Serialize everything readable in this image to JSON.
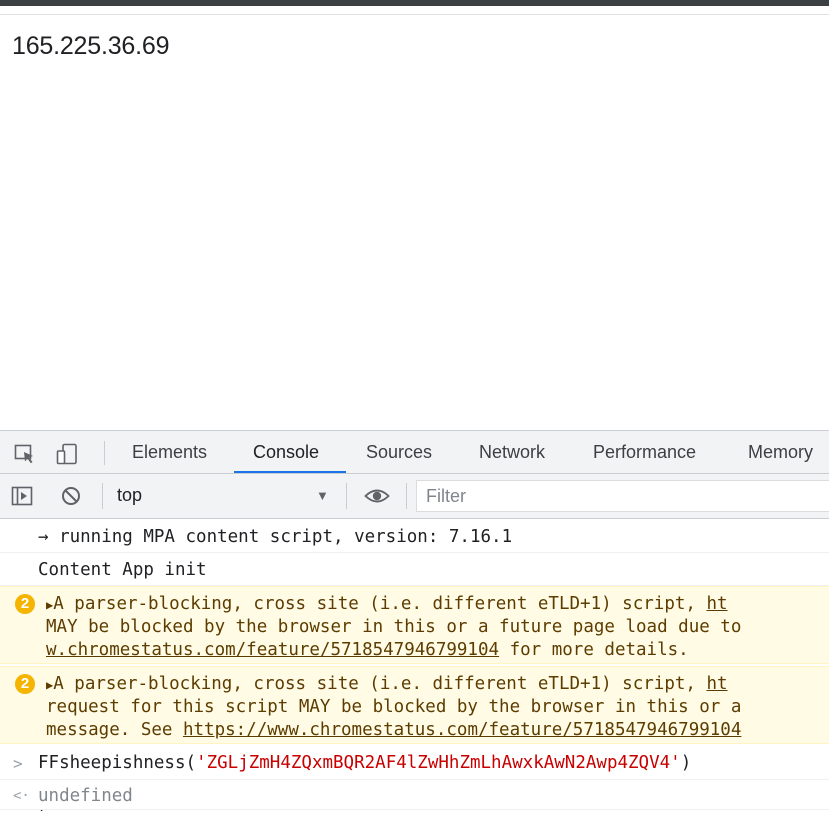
{
  "page": {
    "ip_text": "165.225.36.69"
  },
  "devtools": {
    "tabs": [
      {
        "label": "Elements"
      },
      {
        "label": "Console"
      },
      {
        "label": "Sources"
      },
      {
        "label": "Network"
      },
      {
        "label": "Performance"
      },
      {
        "label": "Memory"
      }
    ],
    "active_tab": "Console",
    "toolbar": {
      "context": "top",
      "filter_placeholder": "Filter"
    },
    "console": {
      "line1": "→ running MPA content script, version: 7.16.1",
      "line2": "Content App init",
      "warning1": {
        "count": "2",
        "text1": "A parser-blocking, cross site (i.e. different eTLD+1) script, ",
        "link1": "ht",
        "text2": "MAY be blocked by the browser in this or a future page load due to",
        "link2": "w.chromestatus.com/feature/5718547946799104",
        "text3": " for more details."
      },
      "warning2": {
        "count": "2",
        "text1": "A parser-blocking, cross site (i.e. different eTLD+1) script, ",
        "link1": "ht",
        "text2": "request for this script MAY be blocked by the browser in this or a",
        "text3": "message. See ",
        "link2": "https://www.chromestatus.com/feature/5718547946799104"
      },
      "input": {
        "prompt": ">",
        "fn": "FFsheepishness(",
        "arg": "'ZGLjZmH4ZQxmBQR2AF4lZwHhZmLhAwxkAwN2Awp4ZQV4'",
        "close": ")"
      },
      "result": {
        "prompt": "<·",
        "value": "undefined"
      },
      "input_caret": "."
    }
  },
  "colors": {
    "active_tab_underline": "#1a73e8",
    "warning_bg": "#fffbe5",
    "warning_badge": "#f4b400",
    "string_literal": "#c80000"
  },
  "icons": {
    "inspect": "inspect-element-icon",
    "device": "device-toolbar-icon",
    "sidebar": "console-sidebar-icon",
    "clear": "clear-console-icon",
    "eye": "live-expression-icon"
  }
}
